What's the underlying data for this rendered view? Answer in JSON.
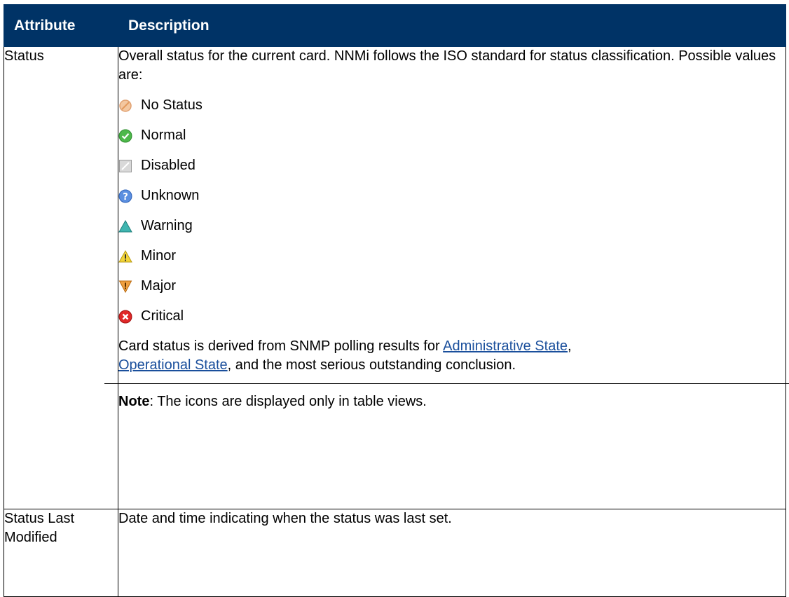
{
  "header": {
    "attribute": "Attribute",
    "description": "Description"
  },
  "rows": [
    {
      "attribute": "Status",
      "intro": "Overall status for the current card. NNMi follows the ISO standard for status classification. Possible values are:",
      "statuses": [
        {
          "label": "No Status",
          "icon": "no-status-icon"
        },
        {
          "label": "Normal",
          "icon": "normal-icon"
        },
        {
          "label": "Disabled",
          "icon": "disabled-icon"
        },
        {
          "label": "Unknown",
          "icon": "unknown-icon"
        },
        {
          "label": "Warning",
          "icon": "warning-icon"
        },
        {
          "label": "Minor",
          "icon": "minor-icon"
        },
        {
          "label": "Major",
          "icon": "major-icon"
        },
        {
          "label": "Critical",
          "icon": "critical-icon"
        }
      ],
      "derived": {
        "prefix": "Card status is derived from SNMP polling results for ",
        "link1": "Administrative State",
        "mid": ", ",
        "link2": "Operational State",
        "suffix": ", and the most serious outstanding conclusion."
      },
      "note": {
        "label": "Note",
        "text": ": The icons are displayed only in table views."
      }
    },
    {
      "attribute": "Status Last Modified",
      "description": "Date and time indicating when the status was last set."
    }
  ],
  "colors": {
    "header_bg": "#003366",
    "link": "#1a4f9c"
  }
}
